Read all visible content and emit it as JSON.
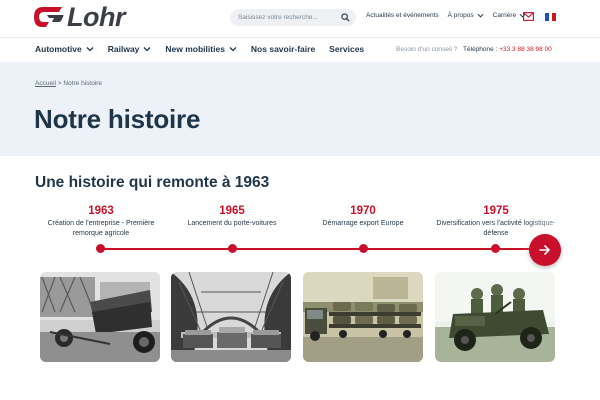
{
  "brand": {
    "name": "Lohr",
    "accent": "#c9102a",
    "navy": "#1f3548"
  },
  "search": {
    "placeholder": "Saisissez votre recherche..."
  },
  "top_links": [
    {
      "label": "Actualités et événements",
      "has_dropdown": false
    },
    {
      "label": "À propos",
      "has_dropdown": true
    },
    {
      "label": "Carrière",
      "has_dropdown": true
    }
  ],
  "icons": {
    "search": "search-icon",
    "mail": "mail-icon",
    "flag": "flag-fr-icon",
    "arrow": "arrow-right-icon"
  },
  "main_nav": [
    {
      "label": "Automotive",
      "has_dropdown": true
    },
    {
      "label": "Railway",
      "has_dropdown": true
    },
    {
      "label": "New mobilities",
      "has_dropdown": true
    },
    {
      "label": "Nos savoir-faire",
      "has_dropdown": false
    },
    {
      "label": "Services",
      "has_dropdown": false
    }
  ],
  "contact": {
    "question": "Besoin d'un conseil ?",
    "tel_label": "Téléphone :",
    "tel_number": "+33 3 88 38 98 00"
  },
  "breadcrumb": {
    "home": "Accueil",
    "separator": ">",
    "current": "Notre histoire"
  },
  "page_title": "Notre histoire",
  "history": {
    "title": "Une histoire qui remonte à 1963",
    "timeline": [
      {
        "year": "1963",
        "label": "Création de l'entreprise - Première remorque agricole"
      },
      {
        "year": "1965",
        "label": "Lancement du porte-voitures"
      },
      {
        "year": "1970",
        "label": "Démarrage export Europe"
      },
      {
        "year": "1975",
        "label": "Diversification vers l'activité logistique-défense"
      }
    ],
    "next_label": "→"
  }
}
